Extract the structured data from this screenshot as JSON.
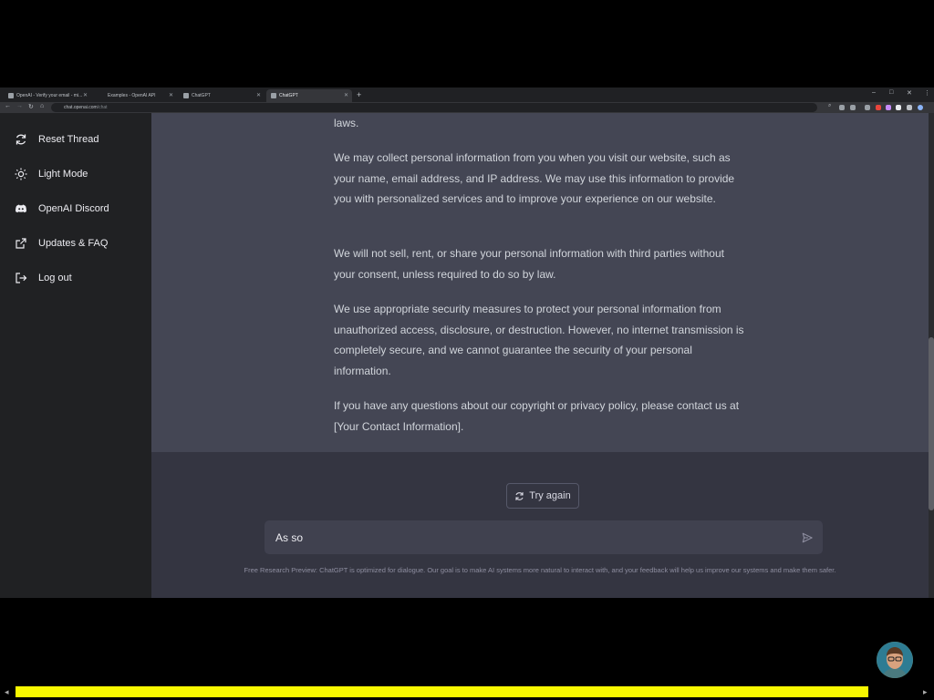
{
  "browser": {
    "tabs": [
      {
        "label": "OpenAI - Verify your email - mi..."
      },
      {
        "label": "Examples - OpenAI API"
      },
      {
        "label": "ChatGPT"
      },
      {
        "label": "ChatGPT"
      }
    ],
    "new_tab_symbol": "+",
    "window_controls": {
      "minimize": "–",
      "maximize": "□",
      "close": "✕"
    },
    "url_host": "chat.openai.com",
    "url_path": "/chat"
  },
  "sidebar": {
    "items": [
      {
        "label": "Reset Thread",
        "icon": "reset-icon"
      },
      {
        "label": "Light Mode",
        "icon": "sun-icon"
      },
      {
        "label": "OpenAI Discord",
        "icon": "discord-icon"
      },
      {
        "label": "Updates & FAQ",
        "icon": "external-link-icon"
      },
      {
        "label": "Log out",
        "icon": "logout-icon"
      }
    ]
  },
  "conversation": {
    "paragraphs": [
      "laws.",
      "We may collect personal information from you when you visit our website, such as your name, email address, and IP address. We may use this information to provide you with personalized services and to improve your experience on our website.",
      "We will not sell, rent, or share your personal information with third parties without your consent, unless required to do so by law.",
      "We use appropriate security measures to protect your personal information from unauthorized access, disclosure, or destruction. However, no internet transmission is completely secure, and we cannot guarantee the security of your personal information.",
      "If you have any questions about our copyright or privacy policy, please contact us at [Your Contact Information]."
    ]
  },
  "composer": {
    "try_again_label": "Try again",
    "input_value": "As so",
    "send_icon": "send-icon"
  },
  "footer_note": "Free Research Preview: ChatGPT is optimized for dialogue. Our goal is to make AI systems more natural to interact with, and your feedback will help us improve our systems and make them safer.",
  "colors": {
    "sidebar_bg": "#202123",
    "main_bg": "#343541",
    "assistant_bg": "#444654",
    "input_bg": "#40414f",
    "highlight_bar": "#f8f800"
  }
}
